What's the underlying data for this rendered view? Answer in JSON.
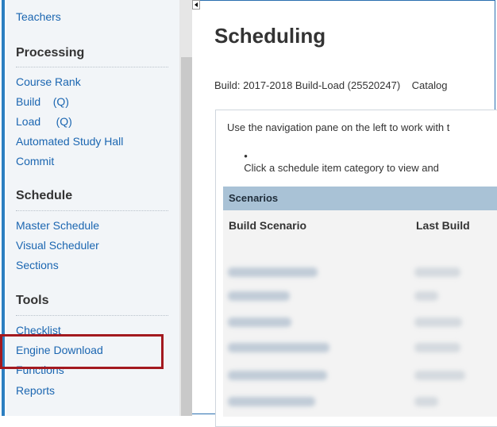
{
  "sidebar": {
    "top_link": "Teachers",
    "sections": [
      {
        "heading": "Processing",
        "items": [
          "Course Rank",
          "Build    (Q)",
          "Load     (Q)",
          "Automated Study Hall",
          "Commit"
        ]
      },
      {
        "heading": "Schedule",
        "items": [
          "Master Schedule",
          "Visual Scheduler",
          "Sections"
        ]
      },
      {
        "heading": "Tools",
        "items": [
          "Checklist",
          "Engine Download",
          "Functions",
          "Reports"
        ]
      }
    ],
    "highlighted_item": "Engine Download"
  },
  "main": {
    "title": "Scheduling",
    "build_line": "Build: 2017-2018 Build-Load (25520247)    Catalog",
    "instructions": {
      "line1": "Use the navigation pane on the left to work with t",
      "bullet": "Click a schedule item category to view and"
    },
    "scenarios": {
      "header": "Scenarios",
      "columns": [
        "Build Scenario",
        "Last Build"
      ]
    }
  },
  "colors": {
    "link": "#1b66b1",
    "highlight_border": "#a3191f",
    "scenario_header_bg": "#a9c2d6"
  }
}
